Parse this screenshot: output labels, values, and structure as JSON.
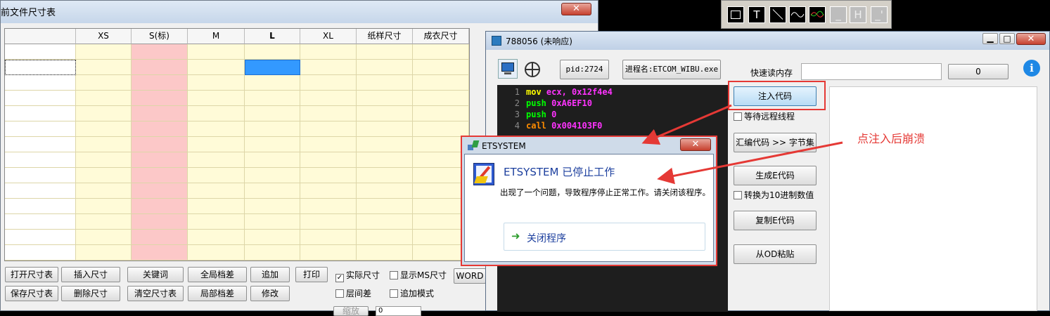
{
  "size_window": {
    "title": "前文件尺寸表",
    "close": "✕",
    "columns": [
      "",
      "XS",
      "S(标)",
      "M",
      "L",
      "XL",
      "纸样尺寸",
      "成衣尺寸"
    ],
    "buttons_row1": [
      "打开尺寸表",
      "插入尺寸",
      "关键词",
      "全局档差",
      "追加",
      "打印"
    ],
    "buttons_row2": [
      "保存尺寸表",
      "删除尺寸",
      "清空尺寸表",
      "局部档差",
      "修改"
    ],
    "checks": [
      {
        "label": "实际尺寸",
        "checked": true
      },
      {
        "label": "显示MS尺寸",
        "checked": false
      },
      {
        "label": "层间差",
        "checked": false
      },
      {
        "label": "追加模式",
        "checked": false
      }
    ],
    "word_button": "WORD",
    "zoom_label": "缩放",
    "zoom_value": "0"
  },
  "toolbar": {
    "icons": [
      "rectangle-tool-icon",
      "text-tool-icon",
      "line-tool-icon",
      "sine-tool-icon",
      "wave-color-tool-icon",
      "minus-tool-icon",
      "h-tool-icon",
      "bracket-tool-icon"
    ],
    "labels": [
      "",
      "T",
      "",
      "",
      "",
      "_",
      "H",
      "_'"
    ]
  },
  "injector": {
    "title": "788056 (未响应)",
    "pid": "pid:2724",
    "process": "进程名:ETCOM_WIBU.exe",
    "quick_read_label": "快速读内存",
    "quick_read_value": "",
    "read_button": "0",
    "code": [
      {
        "n": "1",
        "op": "mov",
        "args": "ecx, 0x12f4e4"
      },
      {
        "n": "2",
        "op": "push",
        "args": "0xA6EF10"
      },
      {
        "n": "3",
        "op": "push",
        "args": "0"
      },
      {
        "n": "4",
        "op": "call",
        "args": "0x004103F0"
      }
    ],
    "inject_button": "注入代码",
    "wait_remote": "等待远程线程",
    "asm_button": "汇编代码 >> 字节集",
    "gen_e_button": "生成E代码",
    "to_decimal": "转换为10进制数值",
    "copy_e_button": "复制E代码",
    "paste_od_button": "从OD粘贴",
    "info": "i",
    "minimize": "▁",
    "maximize": "□",
    "close": "✕"
  },
  "dialog": {
    "title": "ETSYSTEM",
    "close": "✕",
    "heading": "ETSYSTEM 已停止工作",
    "message": "出现了一个问题，导致程序停止正常工作。请关闭该程序。",
    "action": "关闭程序"
  },
  "annotation": {
    "text": "点注入后崩溃",
    "color": "#e53935"
  }
}
